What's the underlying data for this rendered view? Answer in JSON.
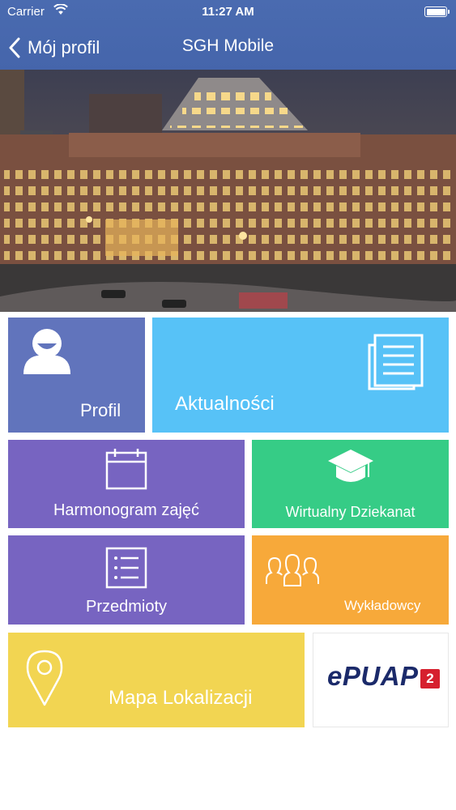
{
  "status_bar": {
    "carrier": "Carrier",
    "time": "11:27 AM"
  },
  "nav": {
    "back_label": "Mój profil",
    "title": "SGH Mobile"
  },
  "tiles": {
    "profil": "Profil",
    "aktualnosci": "Aktualności",
    "harmonogram": "Harmonogram zajęć",
    "wirtualny": "Wirtualny Dziekanat",
    "przedmioty": "Przedmioty",
    "wykladowcy": "Wykładowcy",
    "mapa": "Mapa Lokalizacji",
    "epuap_logo": "ePUAP",
    "epuap_number": "2"
  },
  "colors": {
    "header": "#4565ab",
    "profil": "#6174bc",
    "aktualnosci": "#57c2f7",
    "purple": "#7764c1",
    "green": "#36cc86",
    "orange": "#f7a93a",
    "yellow": "#f2d552",
    "epuap_red": "#d6202e"
  },
  "icons": [
    "wifi-icon",
    "battery-icon",
    "back-chevron-icon",
    "user-icon",
    "news-icon",
    "calendar-icon",
    "graduation-cap-icon",
    "list-icon",
    "people-icon",
    "location-pin-icon"
  ]
}
